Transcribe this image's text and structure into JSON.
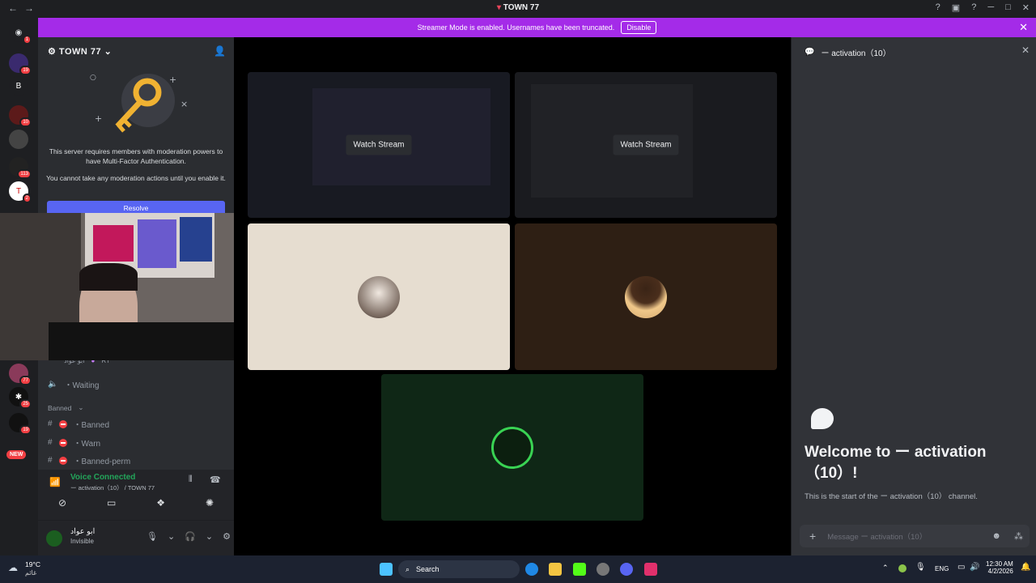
{
  "window": {
    "title": "TOWN 77"
  },
  "banner": {
    "text": "Streamer Mode is enabled. Usernames have been truncated.",
    "button": "Disable"
  },
  "servers": {
    "badges": [
      "1",
      "19",
      "10",
      "113",
      "2",
      "77",
      "25",
      "19"
    ],
    "letter": "B",
    "new_label": "NEW"
  },
  "server": {
    "name": "TOWN 77",
    "mfa_text_1": "This server requires members with moderation powers to have Multi-Factor Authentication.",
    "mfa_text_2": "You cannot take any moderation actions until you enable it.",
    "resolve_button": "Resolve"
  },
  "channel_list": {
    "partial_user": "ابو عواد",
    "partial_tag": "RT",
    "waiting": "・Waiting",
    "category": "Banned",
    "channels": [
      "・Banned",
      "・Warn",
      "・Banned-perm"
    ]
  },
  "voice": {
    "status": "Voice Connected",
    "location": "ー activation（10） / TOWN 77"
  },
  "user": {
    "name": "ابو عواد",
    "status": "Invisible"
  },
  "stage": {
    "watch_label": "Watch Stream"
  },
  "chat": {
    "channel_name": "ー activation（10）",
    "welcome": "Welcome to ー activation（10）!",
    "start_text": "This is the start of the ー activation（10） channel.",
    "input_placeholder": "Message ー activation（10）"
  },
  "taskbar": {
    "weather_temp": "19°C",
    "weather_desc": "غائم",
    "search_label": "Search",
    "lang": "ENG",
    "time": "12:30 AM",
    "date": "4/2/2026"
  },
  "colors": {
    "accent": "#a42be8",
    "blurple": "#5865f2",
    "voice_green": "#23a55a",
    "danger": "#f23f43"
  }
}
